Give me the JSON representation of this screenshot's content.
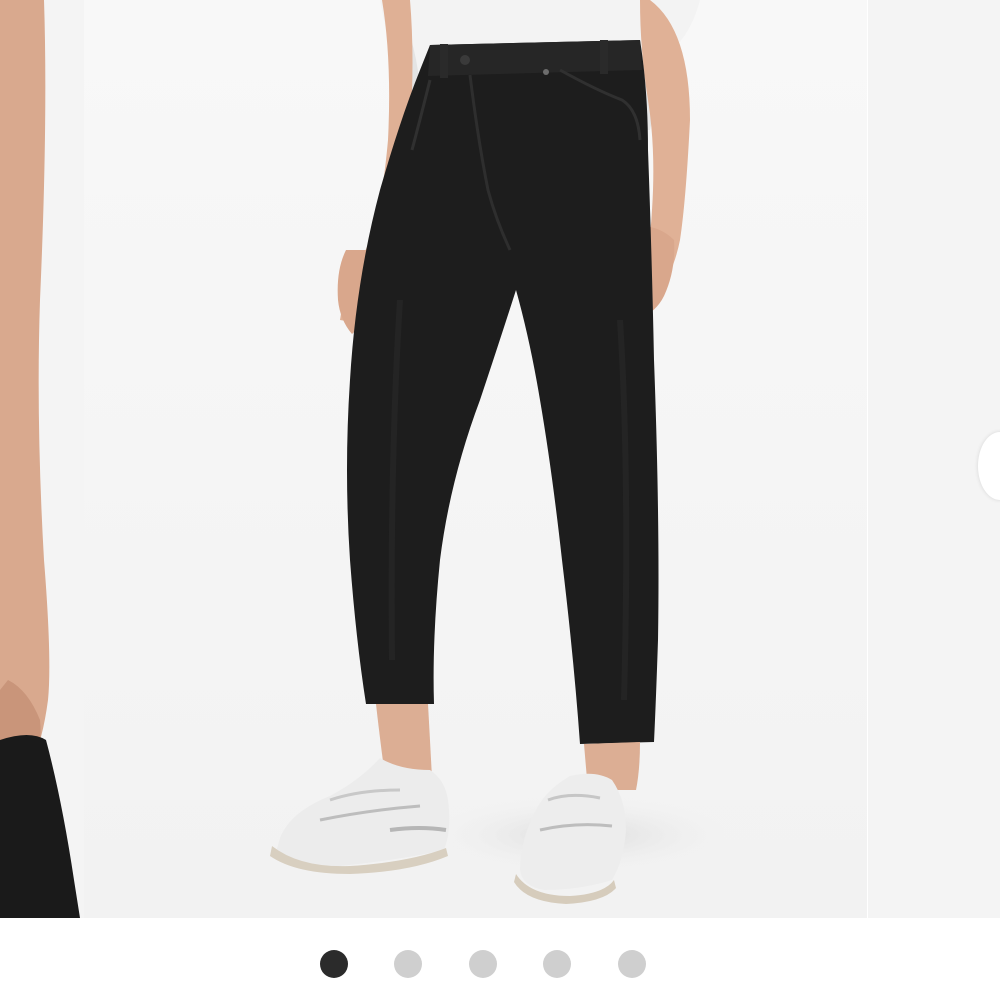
{
  "carousel": {
    "slide_count": 5,
    "active_index": 0,
    "indicator_colors": {
      "active": "#2b2b2b",
      "inactive": "#cfcfcf"
    }
  },
  "photo": {
    "product_color": "#1d1d1d",
    "background_color": "#f7f7f7"
  }
}
